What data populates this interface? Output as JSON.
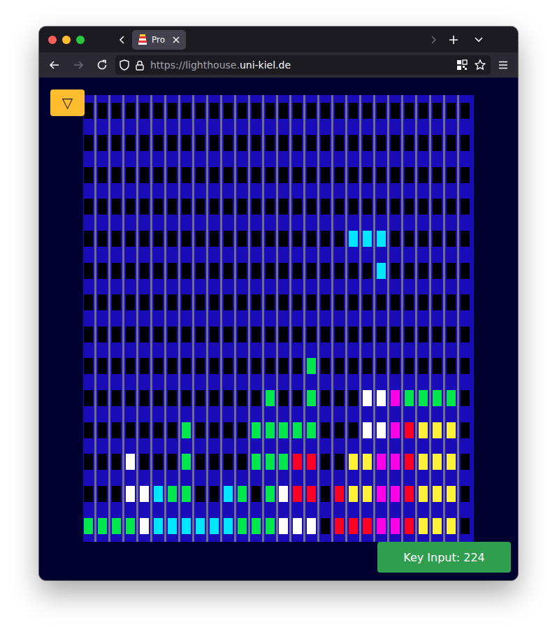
{
  "window": {
    "title": "Pro"
  },
  "tabs": [
    {
      "label": "Pro",
      "selected": true
    }
  ],
  "tab_scroll": {
    "left_enabled": true,
    "right_enabled": false
  },
  "navigation": {
    "back_enabled": true,
    "forward_enabled": false
  },
  "address_bar": {
    "dim_part": "https://lighthouse.",
    "bright_part": "uni-kiel.de"
  },
  "menu_button": "▽",
  "grid": {
    "rows": [
      "............................",
      "............................",
      "............................",
      "............................",
      "...................CCC......",
      ".....................C......",
      "............................",
      "............................",
      "................G...........",
      ".............G..G...WWMGGGG.",
      ".......G....GGGGG...WWMRYYY.",
      "...W...G....GGGRR..YYMMRYYY.",
      "...WWCGG..CG.GWRR.RYYMMRYYY.",
      "GGGGWCCCCCCGGGWWW.RRRMMRYYY."
    ],
    "palette": {
      ".": "#000000",
      "G": "#00e64d",
      "W": "#ffffff",
      "C": "#00e6ff",
      "M": "#ff00e6",
      "R": "#ff0022",
      "Y": "#fff03a"
    }
  },
  "key_input": "Key Input: 224"
}
